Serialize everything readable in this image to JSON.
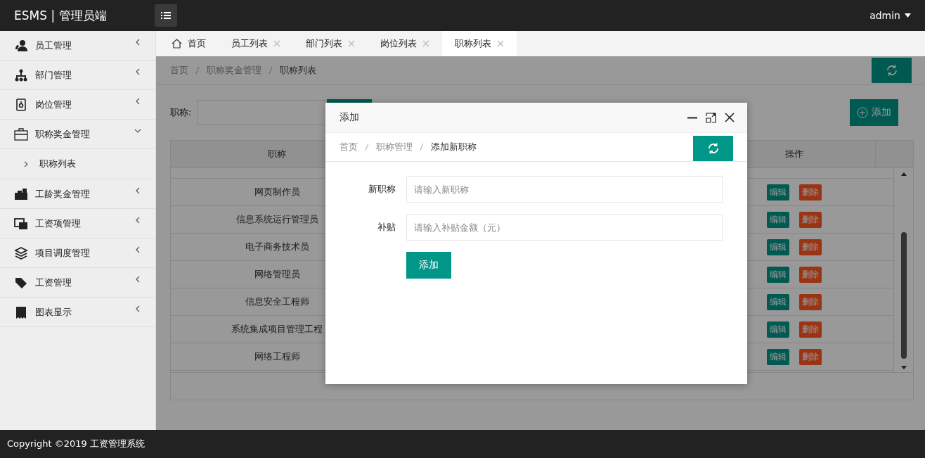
{
  "header": {
    "brand": "ESMS | 管理员端",
    "user": "admin"
  },
  "sidebar": {
    "items": [
      {
        "label": "员工管理",
        "expanded": false
      },
      {
        "label": "部门管理",
        "expanded": false
      },
      {
        "label": "岗位管理",
        "expanded": false
      },
      {
        "label": "职称奖金管理",
        "expanded": true,
        "children": [
          {
            "label": "职称列表"
          }
        ]
      },
      {
        "label": "工龄奖金管理",
        "expanded": false
      },
      {
        "label": "工资项管理",
        "expanded": false
      },
      {
        "label": "项目调度管理",
        "expanded": false
      },
      {
        "label": "工资管理",
        "expanded": false
      },
      {
        "label": "图表显示",
        "expanded": false
      }
    ]
  },
  "tabs": [
    {
      "label": "首页",
      "kind": "home",
      "selected": false
    },
    {
      "label": "员工列表",
      "kind": "closable",
      "selected": false
    },
    {
      "label": "部门列表",
      "kind": "closable",
      "selected": false
    },
    {
      "label": "岗位列表",
      "kind": "closable",
      "selected": false
    },
    {
      "label": "职称列表",
      "kind": "closable",
      "selected": true
    }
  ],
  "breadcrumb": [
    "首页",
    "职称奖金管理",
    "职称列表"
  ],
  "search": {
    "label": "职称:"
  },
  "add_button": "添加",
  "table": {
    "columns": [
      "职称",
      "操作"
    ],
    "rows": [
      {
        "title": "网页制作员",
        "actions": [
          "编辑",
          "删除"
        ]
      },
      {
        "title": "信息系统运行管理员",
        "actions": [
          "编辑",
          "删除"
        ]
      },
      {
        "title": "电子商务技术员",
        "actions": [
          "编辑",
          "删除"
        ]
      },
      {
        "title": "网络管理员",
        "actions": [
          "编辑",
          "删除"
        ]
      },
      {
        "title": "信息安全工程师",
        "actions": [
          "编辑",
          "删除"
        ]
      },
      {
        "title": "系统集成项目管理工程",
        "actions": [
          "编辑",
          "删除"
        ]
      },
      {
        "title": "网络工程师",
        "actions": [
          "编辑",
          "删除"
        ]
      }
    ]
  },
  "dialog": {
    "title": "添加",
    "breadcrumb": [
      "首页",
      "职称管理",
      "添加新职称"
    ],
    "fields": [
      {
        "label": "新职称",
        "placeholder": "请输入新职称"
      },
      {
        "label": "补贴",
        "placeholder": "请输入补贴金额（元）"
      }
    ],
    "submit": "添加"
  },
  "footer": "Copyright ©2019 工资管理系统"
}
